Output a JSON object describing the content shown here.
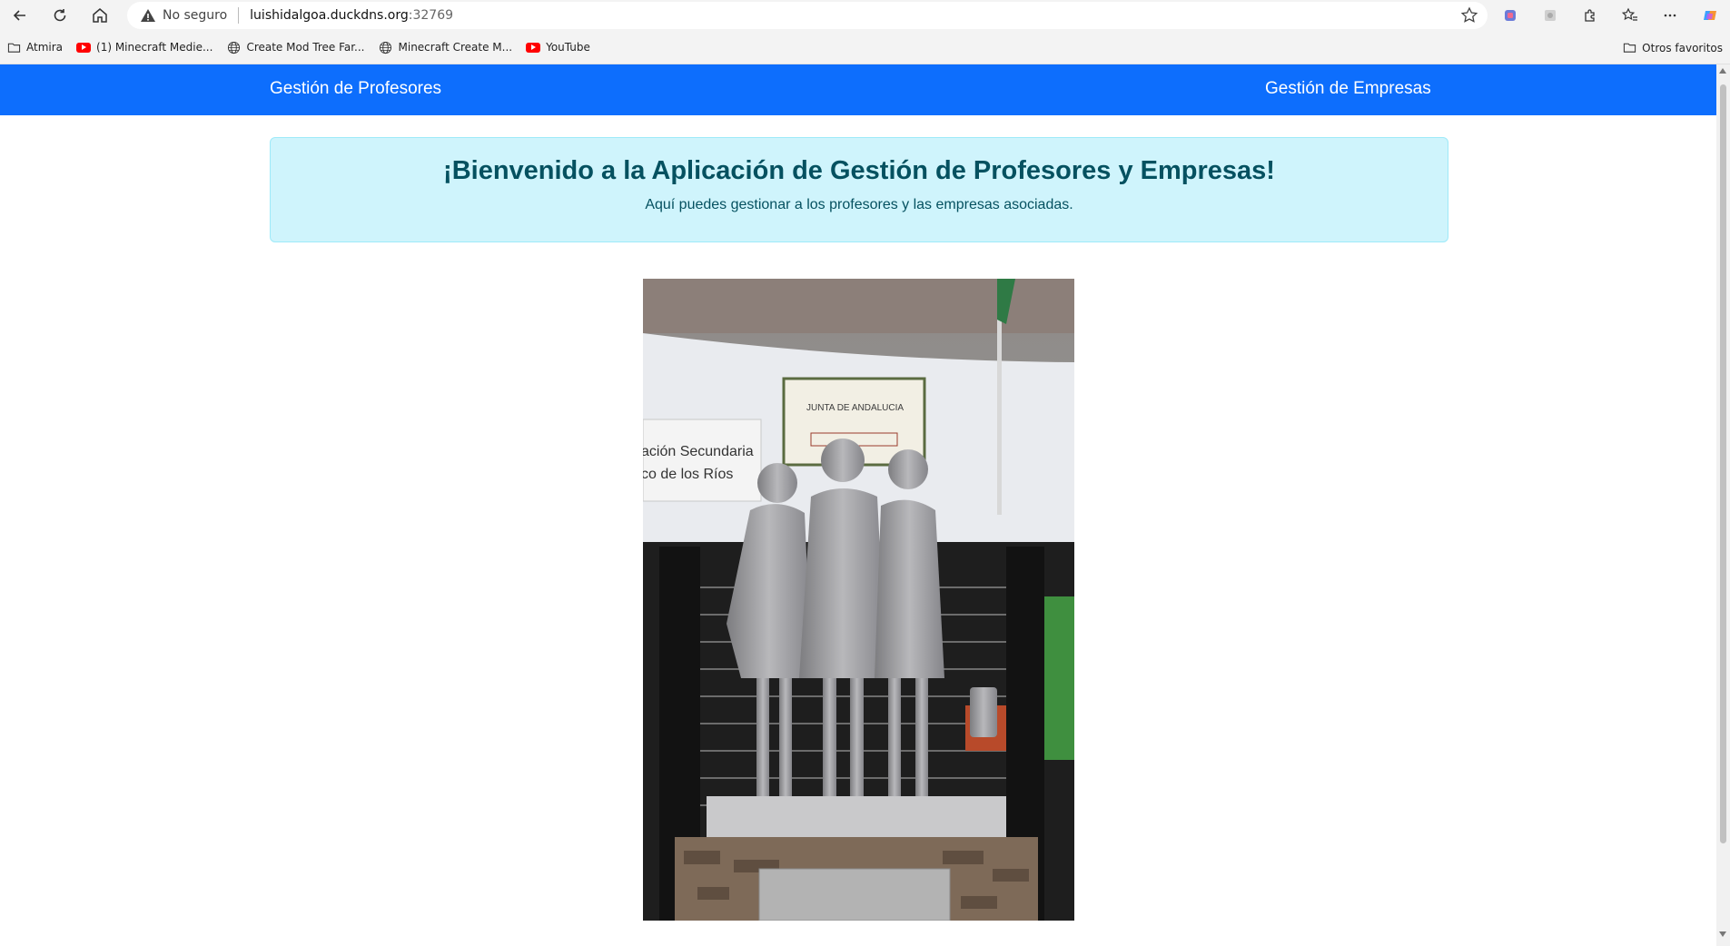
{
  "browser": {
    "address_bar": {
      "security_label": "No seguro",
      "host": "luishidalgoa.duckdns.org",
      "port": ":32769"
    },
    "bookmarks": [
      {
        "label": "Atmira",
        "icon": "folder-icon"
      },
      {
        "label": "(1) Minecraft Medie...",
        "icon": "youtube-icon"
      },
      {
        "label": "Create Mod Tree Far...",
        "icon": "globe-icon"
      },
      {
        "label": "Minecraft Create M...",
        "icon": "globe-icon"
      },
      {
        "label": "YouTube",
        "icon": "youtube-icon"
      }
    ],
    "other_bookmarks": "Otros favoritos"
  },
  "page": {
    "navbar": {
      "left_link": "Gestión de Profesores",
      "right_link": "Gestión de Empresas",
      "color": "#0d6efd"
    },
    "welcome": {
      "title": "¡Bienvenido a la Aplicación de Gestión de Profesores y Empresas!",
      "subtitle": "Aquí puedes gestionar a los profesores y las empresas asociadas."
    },
    "photo": {
      "sign_line1": "JUNTA DE ANDALUCIA",
      "sign_line2": "ación Secundaria",
      "sign_line3": "co de los Ríos"
    }
  }
}
